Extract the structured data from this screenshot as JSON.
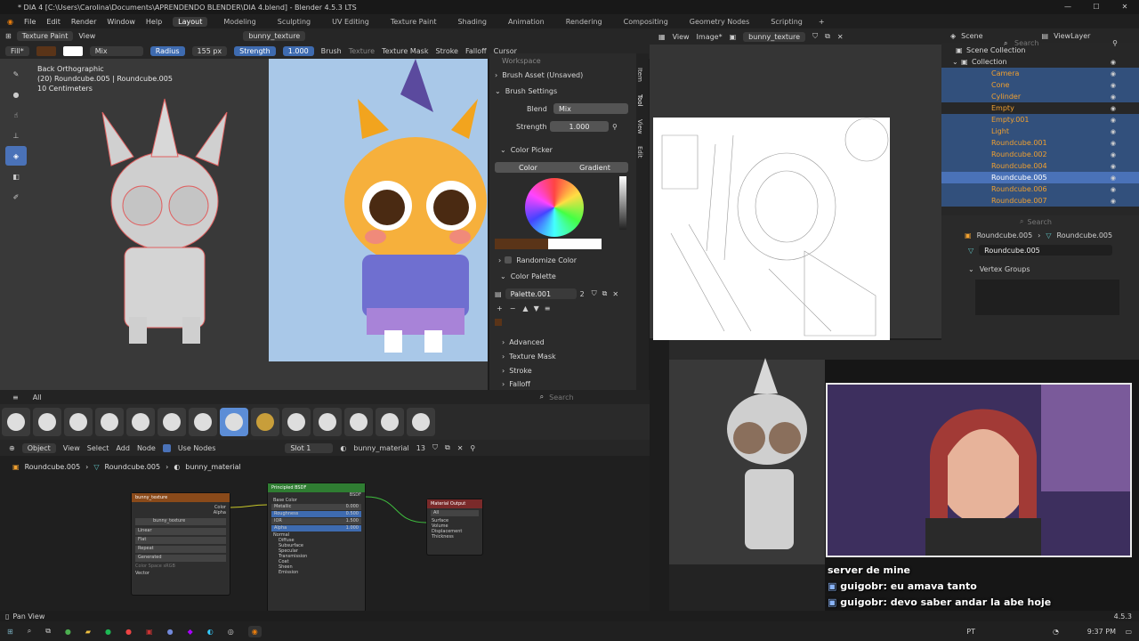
{
  "window": {
    "title": "* DIA 4 [C:\\Users\\Carolina\\Documents\\APRENDENDO BLENDER\\DIA 4.blend] - Blender 4.5.3 LTS"
  },
  "menus": [
    "File",
    "Edit",
    "Render",
    "Window",
    "Help"
  ],
  "workspaces": [
    "Layout",
    "Modeling",
    "Sculpting",
    "UV Editing",
    "Texture Paint",
    "Shading",
    "Animation",
    "Rendering",
    "Compositing",
    "Geometry Nodes",
    "Scripting"
  ],
  "active_workspace": "Layout",
  "tool_header": {
    "mode": "Texture Paint",
    "view": "View",
    "image_name": "bunny_texture",
    "fill": "Fill*",
    "blend": "Mix",
    "radius_label": "Radius",
    "radius_value": "155 px",
    "strength_label": "Strength",
    "strength_value": "1.000",
    "brush": "Brush",
    "texture": "Texture",
    "texture_mask": "Texture Mask",
    "stroke": "Stroke",
    "falloff": "Falloff",
    "cursor": "Cursor"
  },
  "viewport": {
    "view_name": "Back Orthographic",
    "object_info": "(20) Roundcube.005 | Roundcube.005",
    "scale": "10 Centimeters"
  },
  "brush_panel": {
    "workspace_partial": "Workspace",
    "asset": "Brush Asset (Unsaved)",
    "settings_title": "Brush Settings",
    "blend_label": "Blend",
    "blend_value": "Mix",
    "strength_label": "Strength",
    "strength_value": "1.000",
    "color_picker_title": "Color Picker",
    "tab_color": "Color",
    "tab_gradient": "Gradient",
    "randomize": "Randomize Color",
    "palette_title": "Color Palette",
    "palette_name": "Palette.001",
    "palette_users": "2",
    "sections": [
      "Advanced",
      "Texture Mask",
      "Stroke",
      "Falloff"
    ],
    "side_tabs": [
      "Item",
      "Tool",
      "View",
      "Edit"
    ],
    "search_placeholder": "Search"
  },
  "brush_library": {
    "filter": "All"
  },
  "node_editor": {
    "type": "Object",
    "view": "View",
    "select": "Select",
    "add": "Add",
    "node": "Node",
    "use_nodes": "Use Nodes",
    "slot": "Slot 1",
    "material": "bunny_material",
    "users": "13",
    "crumbs": [
      "Roundcube.005",
      "Roundcube.005",
      "bunny_material"
    ]
  },
  "nodes": {
    "tex": {
      "title": "bunny_texture",
      "color": "Color",
      "alpha": "Alpha",
      "image": "bunny_texture",
      "interp": "Linear",
      "proj": "Flat",
      "ext": "Repeat",
      "source": "Generated",
      "colorspace": "Color Space",
      "srgb": "sRGB",
      "vector": "Vector"
    },
    "bsdf": {
      "title": "Principled BSDF",
      "out": "BSDF",
      "base": "Base Color",
      "metallic": "Metallic",
      "metallic_v": "0.000",
      "rough": "Roughness",
      "rough_v": "0.500",
      "ior": "IOR",
      "ior_v": "1.500",
      "alpha": "Alpha",
      "alpha_v": "1.000",
      "normal": "Normal",
      "subs": [
        "Diffuse",
        "Subsurface",
        "Specular",
        "Transmission",
        "Coat",
        "Sheen",
        "Emission"
      ]
    },
    "out": {
      "title": "Material Output",
      "target": "All",
      "surface": "Surface",
      "volume": "Volume",
      "disp": "Displacement",
      "thick": "Thickness"
    }
  },
  "uv_editor": {
    "view": "View",
    "image": "Image*",
    "image_name": "bunny_texture"
  },
  "outliner": {
    "scene": "Scene",
    "view_layer": "ViewLayer",
    "search": "Search",
    "scene_collection": "Scene Collection",
    "collection": "Collection",
    "items": [
      "Camera",
      "Cone",
      "Cylinder",
      "Empty",
      "Empty.001",
      "Light",
      "Roundcube.001",
      "Roundcube.002",
      "Roundcube.004",
      "Roundcube.005",
      "Roundcube.006",
      "Roundcube.007"
    ]
  },
  "properties": {
    "object": "Roundcube.005",
    "mesh": "Roundcube.005",
    "data_name": "Roundcube.005",
    "vertex_groups": "Vertex Groups",
    "search": "Search"
  },
  "status": {
    "pan": "Pan View",
    "version": "4.5.3"
  },
  "chat": {
    "line1": "server de mine",
    "user": "guigobr",
    "msg1": "eu amava tanto",
    "msg2": "devo saber andar la abe hoje"
  },
  "taskbar": {
    "lang": "PT",
    "time": "9:37 PM"
  },
  "colors": {
    "accent": "#4a72b8",
    "selection": "#32507c",
    "node_tex": "#8a4a1a",
    "node_bsdf": "#2f7d32",
    "node_out": "#7a2a2a"
  }
}
